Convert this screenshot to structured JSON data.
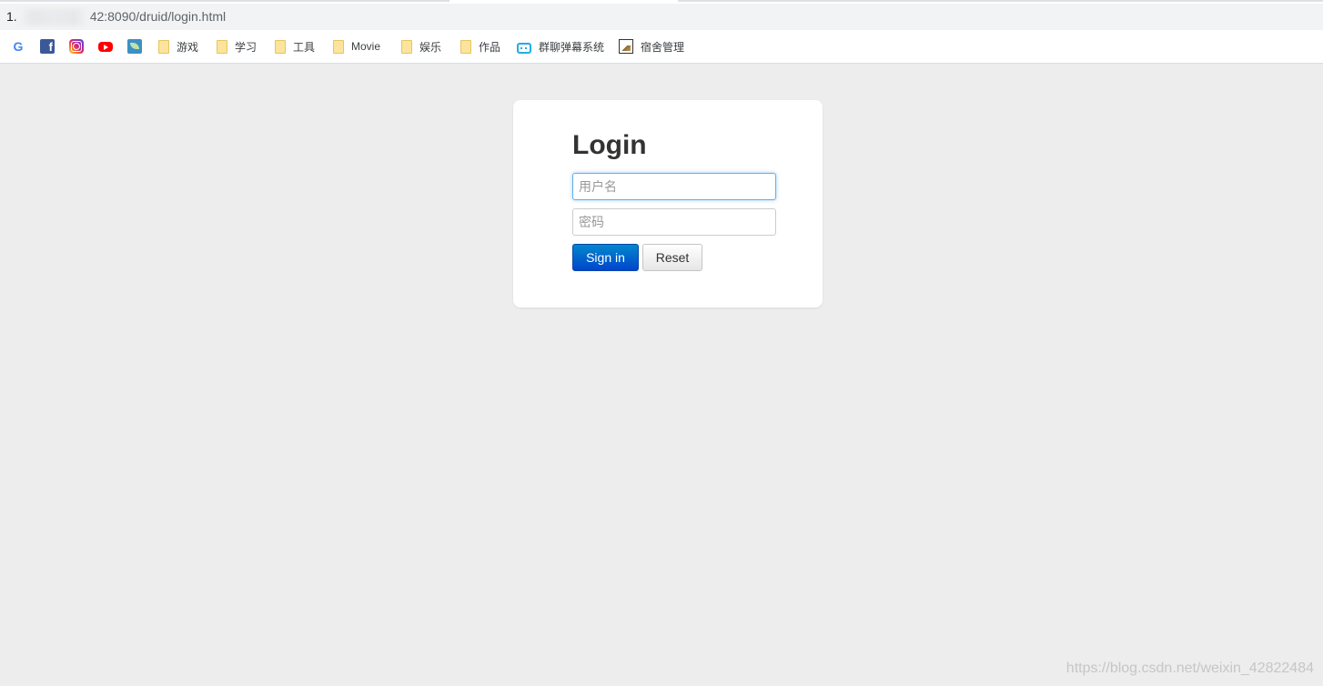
{
  "browser": {
    "address": {
      "prefix": "1.",
      "suffix": "42:8090/druid/login.html"
    },
    "bookmarks": [
      {
        "icon": "google-icon",
        "label": ""
      },
      {
        "icon": "facebook-icon",
        "label": ""
      },
      {
        "icon": "instagram-icon",
        "label": ""
      },
      {
        "icon": "youtube-icon",
        "label": ""
      },
      {
        "icon": "leaf-app-icon",
        "label": ""
      },
      {
        "icon": "folder-icon",
        "label": "游戏"
      },
      {
        "icon": "folder-icon",
        "label": "学习"
      },
      {
        "icon": "folder-icon",
        "label": "工具"
      },
      {
        "icon": "folder-icon",
        "label": "Movie"
      },
      {
        "icon": "folder-icon",
        "label": "娱乐"
      },
      {
        "icon": "folder-icon",
        "label": "作品"
      },
      {
        "icon": "bilibili-tv-icon",
        "label": "群聊弹幕系统"
      },
      {
        "icon": "picture-icon",
        "label": "宿舍管理"
      }
    ]
  },
  "login": {
    "title": "Login",
    "username_placeholder": "用户名",
    "password_placeholder": "密码",
    "sign_in_label": "Sign in",
    "reset_label": "Reset"
  },
  "watermark": "https://blog.csdn.net/weixin_42822484",
  "colors": {
    "page_bg": "#ededed",
    "primary_button": "#0055cc",
    "focus_border": "#66afe9",
    "title_text": "#333333"
  }
}
